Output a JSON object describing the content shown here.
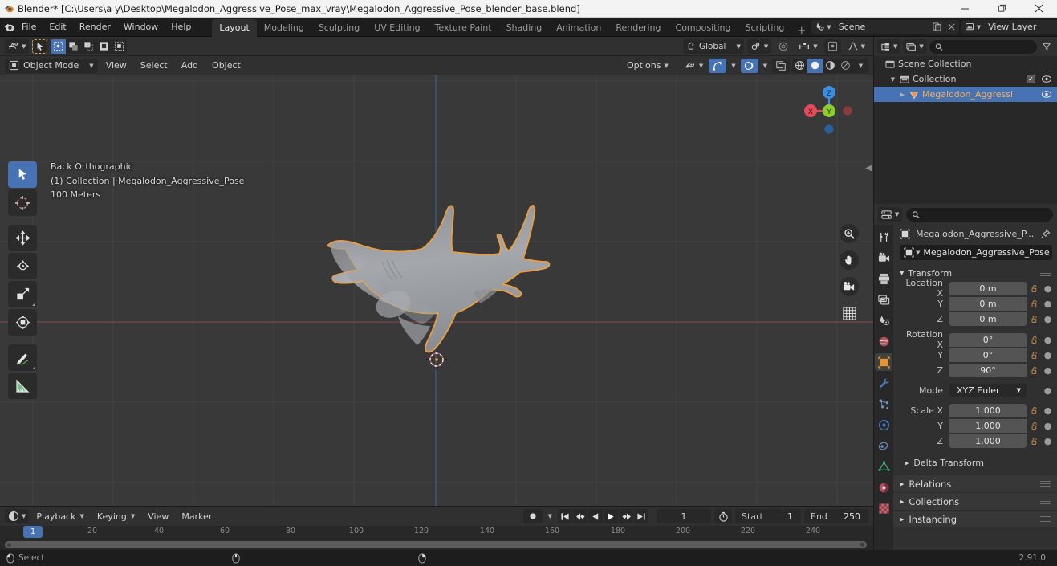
{
  "window": {
    "title": "Blender* [C:\\Users\\a y\\Desktop\\Megalodon_Aggressive_Pose_max_vray\\Megalodon_Aggressive_Pose_blender_base.blend]",
    "minimize": "—",
    "maximize": "❐",
    "close": "✕"
  },
  "topbar": {
    "menus": [
      "File",
      "Edit",
      "Render",
      "Window",
      "Help"
    ],
    "workspaces": [
      {
        "label": "Layout",
        "active": true
      },
      {
        "label": "Modeling",
        "active": false
      },
      {
        "label": "Sculpting",
        "active": false
      },
      {
        "label": "UV Editing",
        "active": false
      },
      {
        "label": "Texture Paint",
        "active": false
      },
      {
        "label": "Shading",
        "active": false
      },
      {
        "label": "Animation",
        "active": false
      },
      {
        "label": "Rendering",
        "active": false
      },
      {
        "label": "Compositing",
        "active": false
      },
      {
        "label": "Scripting",
        "active": false
      }
    ],
    "add_workspace": "+",
    "scene_name": "Scene",
    "view_layer_name": "View Layer"
  },
  "viewport_header": {
    "editor_type": "editor-type-3d-viewport",
    "transform_orientation": "Global",
    "options_label": "Options",
    "mode": "Object Mode",
    "menus": [
      "View",
      "Select",
      "Add",
      "Object"
    ]
  },
  "viewport": {
    "overlay_line1": "Back Orthographic",
    "overlay_line2": "(1) Collection | Megalodon_Aggressive_Pose",
    "overlay_line3": "100 Meters",
    "gizmo_axes": {
      "x": "X",
      "y": "Y",
      "z": "Z"
    },
    "colors": {
      "background": "#393939",
      "selection_outline": "#ed9e3f",
      "axis_z_blue": "#4772b3",
      "axis_x_red": "#b34b4b",
      "gizmo_x": "#e04c5a",
      "gizmo_y": "#8dcd2f",
      "gizmo_z": "#3c8ee0",
      "model_fill": "#9a9da1"
    }
  },
  "outliner": {
    "search_placeholder": "",
    "rows": [
      {
        "label": "Scene Collection",
        "indent": 0,
        "selected": false,
        "has_disclosure": false,
        "has_checkbox": false,
        "has_eye": false
      },
      {
        "label": "Collection",
        "indent": 1,
        "selected": false,
        "has_disclosure": true,
        "has_checkbox": true,
        "has_eye": true
      },
      {
        "label": "Megalodon_Aggressi",
        "indent": 2,
        "selected": true,
        "has_disclosure": true,
        "has_checkbox": false,
        "has_eye": true
      }
    ]
  },
  "properties": {
    "search_placeholder": "",
    "breadcrumb_object": "Megalodon_Aggressive_P...",
    "object_name_field": "Megalodon_Aggressive_Pose",
    "tabs": [
      {
        "name": "tool",
        "active": false
      },
      {
        "name": "render",
        "active": false
      },
      {
        "name": "output",
        "active": false
      },
      {
        "name": "view-layer",
        "active": false
      },
      {
        "name": "scene",
        "active": false
      },
      {
        "name": "world",
        "active": false
      },
      {
        "name": "object",
        "active": true
      },
      {
        "name": "modifiers",
        "active": false
      },
      {
        "name": "particles",
        "active": false
      },
      {
        "name": "physics",
        "active": false
      },
      {
        "name": "constraints",
        "active": false
      },
      {
        "name": "object-data",
        "active": false
      },
      {
        "name": "material",
        "active": false
      },
      {
        "name": "texture",
        "active": false
      }
    ],
    "transform": {
      "title": "Transform",
      "location": {
        "label": "Location",
        "x_label": "Location X",
        "y_label": "Y",
        "z_label": "Z",
        "x": "0 m",
        "y": "0 m",
        "z": "0 m"
      },
      "rotation": {
        "x_label": "Rotation X",
        "y_label": "Y",
        "z_label": "Z",
        "x": "0°",
        "y": "0°",
        "z": "90°"
      },
      "mode": {
        "label": "Mode",
        "value": "XYZ Euler"
      },
      "scale": {
        "x_label": "Scale X",
        "y_label": "Y",
        "z_label": "Z",
        "x": "1.000",
        "y": "1.000",
        "z": "1.000"
      },
      "delta_transform": "Delta Transform"
    },
    "panels": [
      "Relations",
      "Collections",
      "Instancing"
    ]
  },
  "timeline": {
    "editor_label": "timeline-editor",
    "menus": [
      "Playback",
      "Keying",
      "View",
      "Marker"
    ],
    "current_frame": "1",
    "start_label": "Start",
    "start_value": "1",
    "end_label": "End",
    "end_value": "250",
    "playhead_frame": "1",
    "ticks": [
      20,
      40,
      60,
      80,
      100,
      120,
      140,
      160,
      180,
      200,
      220,
      240
    ]
  },
  "statusbar": {
    "select_hint": "Select",
    "version": "2.91.0"
  }
}
